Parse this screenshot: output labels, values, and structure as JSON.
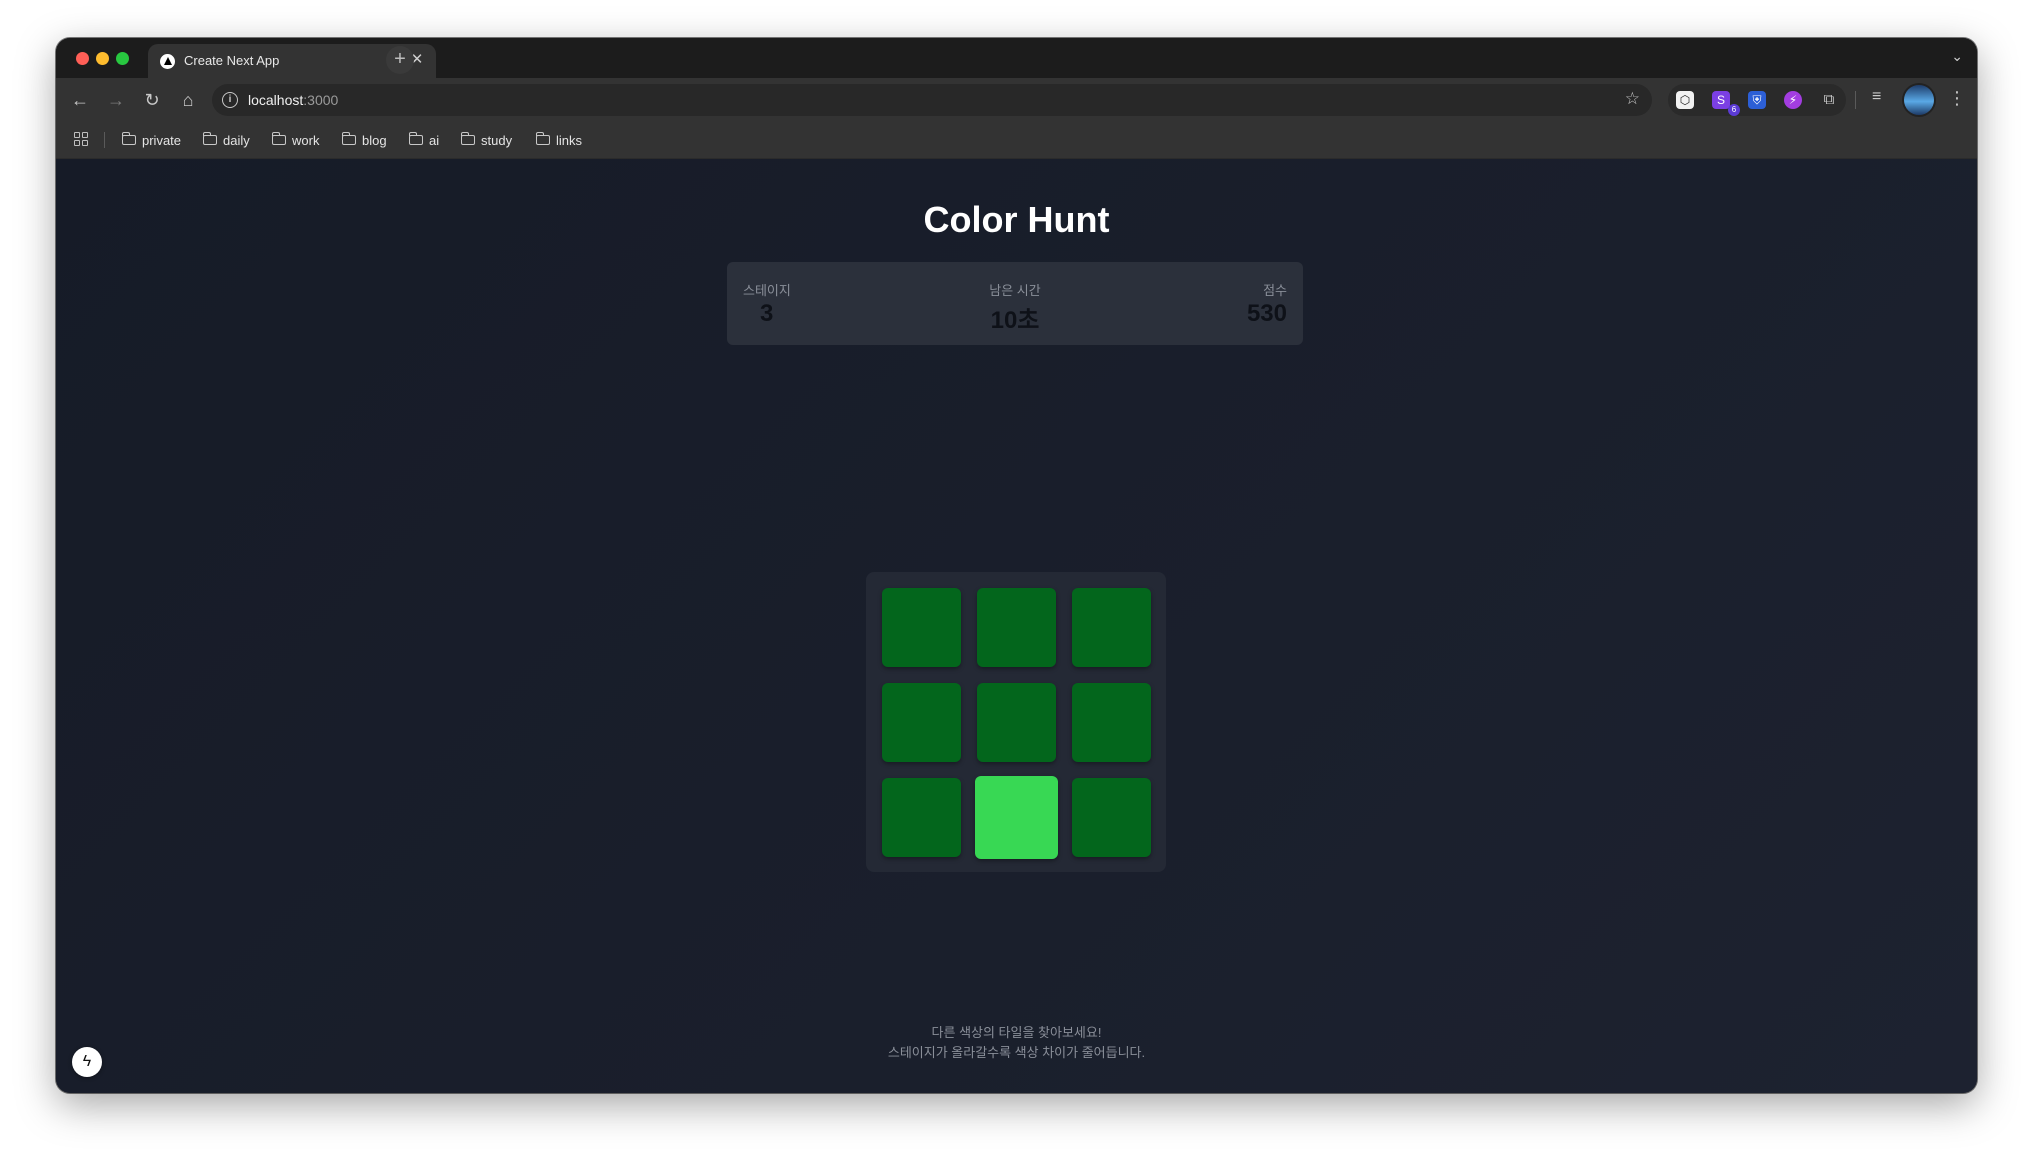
{
  "browser": {
    "tab_title": "Create Next App",
    "tab_close": "✕",
    "new_tab": "+",
    "url_host": "localhost",
    "url_port": ":3000",
    "bookmarks": [
      "private",
      "daily",
      "work",
      "blog",
      "ai",
      "study",
      "links"
    ],
    "extension_badge": "6"
  },
  "game": {
    "title": "Color Hunt",
    "stats": {
      "stage_label": "스테이지",
      "stage_value": "3",
      "time_label": "남은 시간",
      "time_value": "10초",
      "score_label": "점수",
      "score_value": "530"
    },
    "grid": {
      "rows": 3,
      "cols": 3,
      "base_color": "#03661c",
      "odd_color": "#38d854",
      "odd_index": 7
    },
    "hint_line1": "다른 색상의 타일을 찾아보세요!",
    "hint_line2": "스테이지가 올라갈수록 색상 차이가 줄어듭니다."
  },
  "icons": {
    "back": "back-arrow-icon",
    "forward": "forward-arrow-icon",
    "reload": "reload-icon",
    "home": "home-icon",
    "info": "site-info-icon",
    "star": "star-icon",
    "extensions": "puzzle-icon",
    "menu": "kebab-menu-icon",
    "devtools": "lightning-icon"
  }
}
